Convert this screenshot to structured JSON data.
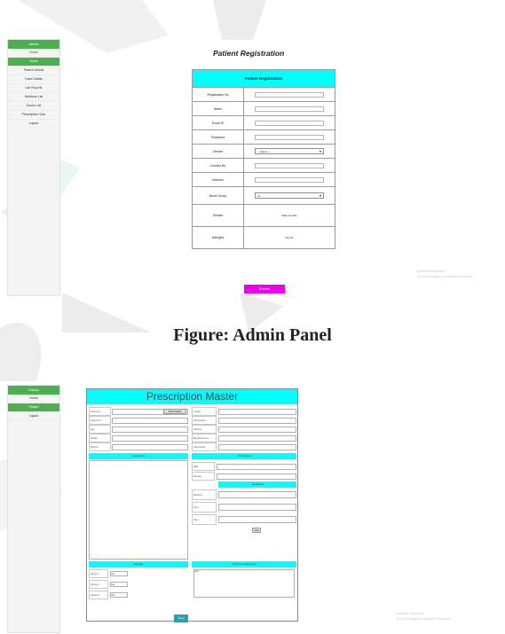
{
  "admin_panel": {
    "sidebar": {
      "header": "Admin",
      "items": [
        "Home",
        "Nurse",
        "Patient Details",
        "Case Details",
        "Lab Reports",
        "Medicine List",
        "Doctor List",
        "Prescription Sum",
        "Logout"
      ],
      "active_index": 1
    },
    "page_title": "Patient Registration",
    "form": {
      "header": "Patient Registration",
      "fields": [
        {
          "label": "Registration No",
          "type": "input",
          "value": ""
        },
        {
          "label": "Name",
          "type": "input",
          "value": ""
        },
        {
          "label": "Email ID",
          "type": "input",
          "value": ""
        },
        {
          "label": "Password",
          "type": "input",
          "value": ""
        },
        {
          "label": "Gender",
          "type": "select",
          "value": "-- Select --"
        },
        {
          "label": "Contact No",
          "type": "input",
          "value": ""
        },
        {
          "label": "Address",
          "type": "input",
          "value": ""
        },
        {
          "label": "Blood Group",
          "type": "select",
          "value": "A+"
        },
        {
          "label": "Gender",
          "type": "radio",
          "value": "Male  Female"
        },
        {
          "label": "Allergies",
          "type": "radio",
          "value": "Yes  No"
        }
      ],
      "submit_label": "Submit"
    },
    "activate_windows": [
      "Activate Windows",
      "Go to Settings to activate Windows."
    ]
  },
  "caption": "Figure: Admin Panel",
  "doctor_panel": {
    "sidebar": {
      "header": "Doctor",
      "items": [
        "Home",
        "Patient",
        "Logout"
      ],
      "active_index": 1
    },
    "title": "Prescription Master",
    "left_fields": [
      "Patient ID",
      "Patient Nm",
      "Age",
      "Weight",
      "Mob No"
    ],
    "search_label": "Show Details",
    "right_fields": [
      "Gender",
      "Temperature",
      "Address",
      "Blood Pressure",
      "Case Detail"
    ],
    "symptoms_header": "Symptoms",
    "prescription_header": "Prescription",
    "presc_fields": [
      "Date",
      "Disease"
    ],
    "medicines_header": "Medicines",
    "medicine_fields": [
      "Medicine",
      "Dose",
      "Days"
    ],
    "add_label": "Add",
    "allergies_header": "Allergies",
    "allergy_fields": [
      "Allergy 1",
      "Allergy 2",
      "Allergy 3"
    ],
    "allergy_values": [
      "Yes",
      "Yes",
      "Yes"
    ],
    "next_visit_header": "Recommended Test",
    "next_visit_value": "Test",
    "save_label": "Save",
    "activate_windows": [
      "Activate Windows",
      "Go to Settings to activate Windows."
    ]
  }
}
